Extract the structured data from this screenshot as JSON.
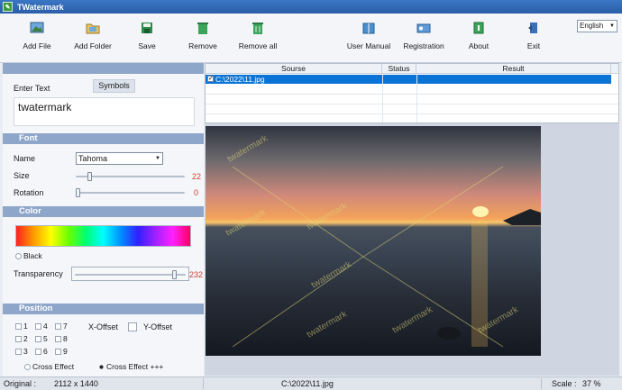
{
  "window": {
    "title": "TWatermark"
  },
  "toolbar": {
    "add_file": "Add File",
    "add_folder": "Add Folder",
    "save": "Save",
    "remove": "Remove",
    "remove_all": "Remove all",
    "user_manual": "User Manual",
    "registration": "Registration",
    "about": "About",
    "exit": "Exit",
    "language": "English"
  },
  "text_section": {
    "label": "Enter Text",
    "symbols_button": "Symbols",
    "value": "twatermark"
  },
  "font_section": {
    "title": "Font",
    "name_label": "Name",
    "name_value": "Tahoma",
    "size_label": "Size",
    "size_value": "22",
    "rotation_label": "Rotation",
    "rotation_value": "0"
  },
  "color_section": {
    "title": "Color",
    "black_label": "Black",
    "transparency_label": "Transparency",
    "transparency_value": "232"
  },
  "position_section": {
    "title": "Position",
    "grid": [
      "1",
      "4",
      "7",
      "2",
      "5",
      "8",
      "3",
      "6",
      "9"
    ],
    "x_offset": "X-Offset",
    "y_offset": "Y-Offset",
    "cross_effect": "Cross Effect",
    "cross_effect_plus": "Cross Effect +++"
  },
  "file_grid": {
    "columns": [
      "Sourse",
      "Status",
      "Result"
    ],
    "rows": [
      {
        "source": "C:\\2022\\11.jpg",
        "status": "",
        "result": ""
      }
    ]
  },
  "preview": {
    "watermark_text": "twatermark"
  },
  "statusbar": {
    "original_label": "Original :",
    "original_value": "2112 x 1440",
    "file_path": "C:\\2022\\11.jpg",
    "scale_label": "Scale :",
    "scale_value": "37 %"
  }
}
